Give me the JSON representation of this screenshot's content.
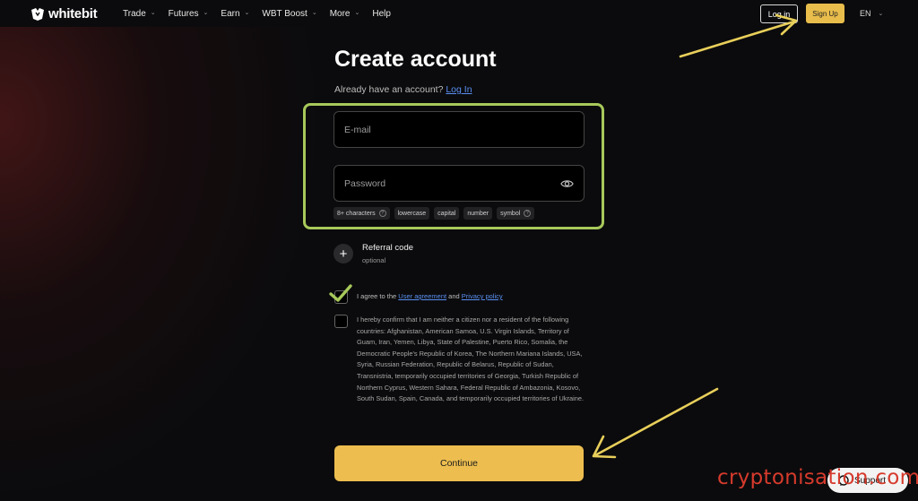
{
  "brand": {
    "logo_text": "whitebit"
  },
  "nav": {
    "items": [
      {
        "label": "Trade",
        "has_dropdown": true
      },
      {
        "label": "Futures",
        "has_dropdown": true
      },
      {
        "label": "Earn",
        "has_dropdown": true
      },
      {
        "label": "WBT Boost",
        "has_dropdown": true
      },
      {
        "label": "More",
        "has_dropdown": true
      },
      {
        "label": "Help",
        "has_dropdown": false
      }
    ],
    "login_label": "Log in",
    "signup_label": "Sign Up",
    "language": "EN"
  },
  "form": {
    "title": "Create account",
    "already_text": "Already have an account?",
    "login_link": "Log In",
    "email_placeholder": "E-mail",
    "password_placeholder": "Password",
    "password_rules": [
      {
        "label": "8+ characters",
        "has_help": true
      },
      {
        "label": "lowercase",
        "has_help": false
      },
      {
        "label": "capital",
        "has_help": false
      },
      {
        "label": "number",
        "has_help": false
      },
      {
        "label": "symbol",
        "has_help": true
      }
    ],
    "referral_label": "Referral code",
    "referral_sub": "optional",
    "agree_prefix": "I agree to the",
    "agree_link1": "User agreement",
    "agree_and": "and",
    "agree_link2": "Privacy policy",
    "confirm_text": "I hereby confirm that I am neither a citizen nor a resident of the following countries: Afghanistan, American Samoa, U.S. Virgin Islands, Territory of Guam, Iran, Yemen, Libya, State of Palestine, Puerto Rico, Somalia, the Democratic People's Republic of Korea, The Northern Mariana Islands, USA, Syria, Russian Federation, Republic of Belarus, Republic of Sudan, Transnistria, temporarily occupied territories of Georgia, Turkish Republic of Northern Cyprus, Western Sahara, Federal Republic of Ambazonia, Kosovo, South Sudan, Spain, Canada, and temporarily occupied territories of Ukraine.",
    "continue_label": "Continue"
  },
  "support": {
    "label": "Support"
  },
  "watermark": "cryptonisation.com",
  "colors": {
    "accent": "#edbe4f",
    "link": "#5a8ff0",
    "highlight": "#a7c95a",
    "annotation_arrow": "#e8cf5a",
    "watermark": "#d63a2c"
  }
}
